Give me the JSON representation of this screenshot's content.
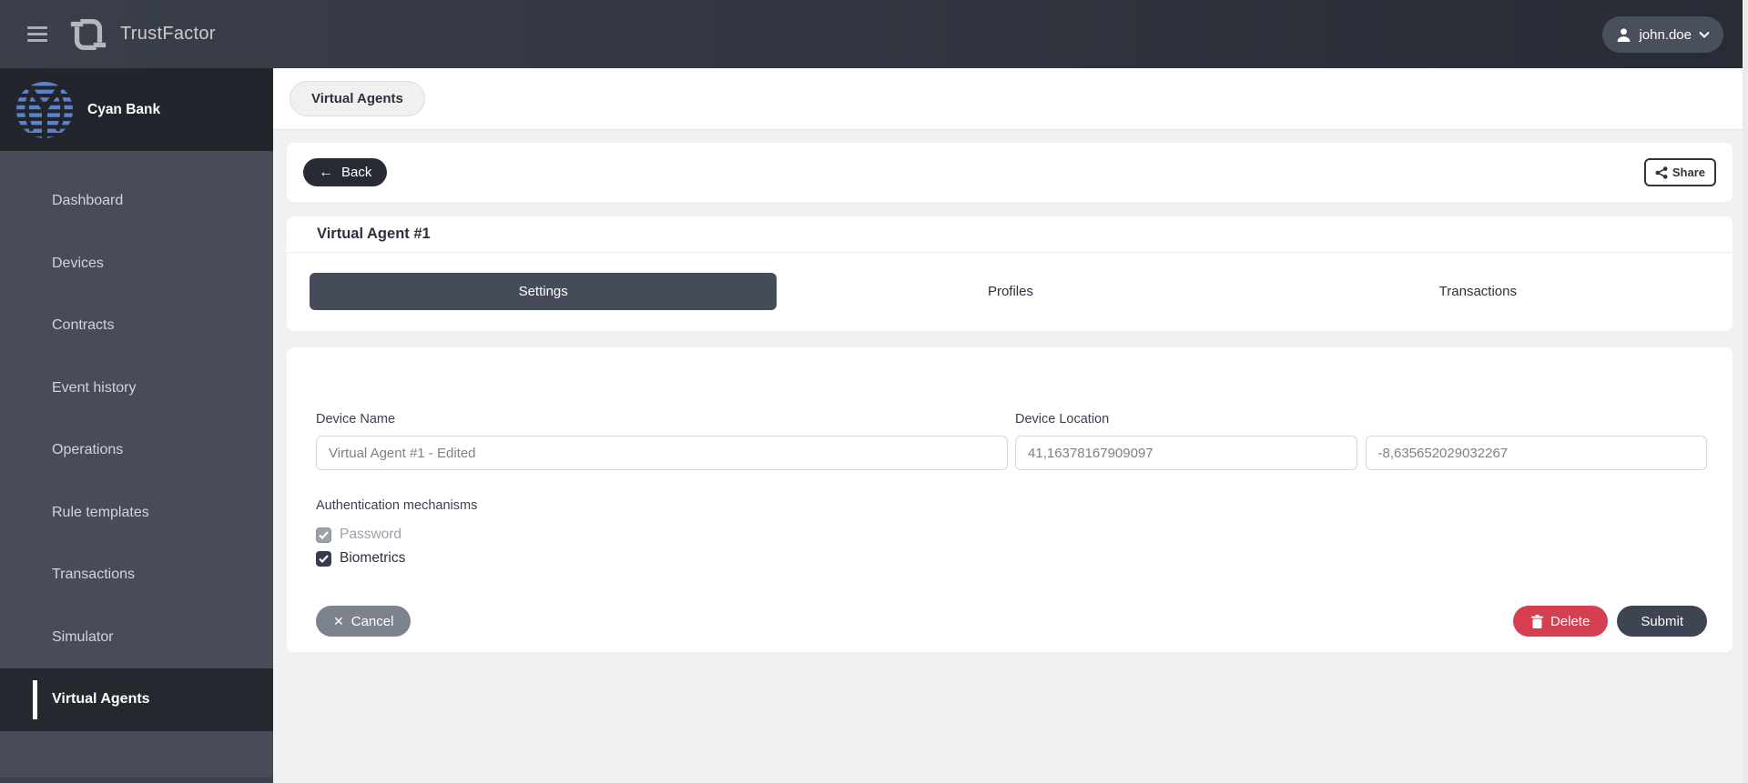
{
  "navbar": {
    "brand": "TrustFactor",
    "user": "john.doe"
  },
  "sidebar": {
    "bank_name": "Cyan Bank",
    "items": [
      {
        "label": "Dashboard",
        "active": false
      },
      {
        "label": "Devices",
        "active": false
      },
      {
        "label": "Contracts",
        "active": false
      },
      {
        "label": "Event history",
        "active": false
      },
      {
        "label": "Operations",
        "active": false
      },
      {
        "label": "Rule templates",
        "active": false
      },
      {
        "label": "Transactions",
        "active": false
      },
      {
        "label": "Simulator",
        "active": false
      },
      {
        "label": "Virtual Agents",
        "active": true
      }
    ]
  },
  "breadcrumb": {
    "label": "Virtual Agents"
  },
  "toolbar": {
    "back_label": "Back",
    "share_label": "Share"
  },
  "detail": {
    "title": "Virtual Agent #1",
    "tabs": [
      {
        "label": "Settings",
        "active": true
      },
      {
        "label": "Profiles",
        "active": false
      },
      {
        "label": "Transactions",
        "active": false
      }
    ]
  },
  "form": {
    "device_name": {
      "label": "Device Name",
      "value": "Virtual Agent #1 - Edited"
    },
    "device_location": {
      "label": "Device Location",
      "latitude": "41,16378167909097",
      "longitude": "-8,635652029032267"
    },
    "auth": {
      "label": "Authentication mechanisms",
      "options": [
        {
          "label": "Password",
          "checked": true,
          "disabled": true
        },
        {
          "label": "Biometrics",
          "checked": true,
          "disabled": false
        }
      ]
    },
    "buttons": {
      "cancel": "Cancel",
      "delete": "Delete",
      "submit": "Submit"
    }
  },
  "colors": {
    "navbar-left": "#3a3f4a",
    "navbar-right": "#282c35",
    "sidebar-bg": "#474c58",
    "sidebar-header-bg": "#22252c",
    "active-item-bg": "#25282e",
    "logo-blue": "#5b83cb",
    "tab-active-bg": "#454b59",
    "danger": "#d63e52",
    "submit-bg": "#3e4452",
    "cancel-bg": "#7d838c",
    "content-bg": "#f0f1f2"
  }
}
